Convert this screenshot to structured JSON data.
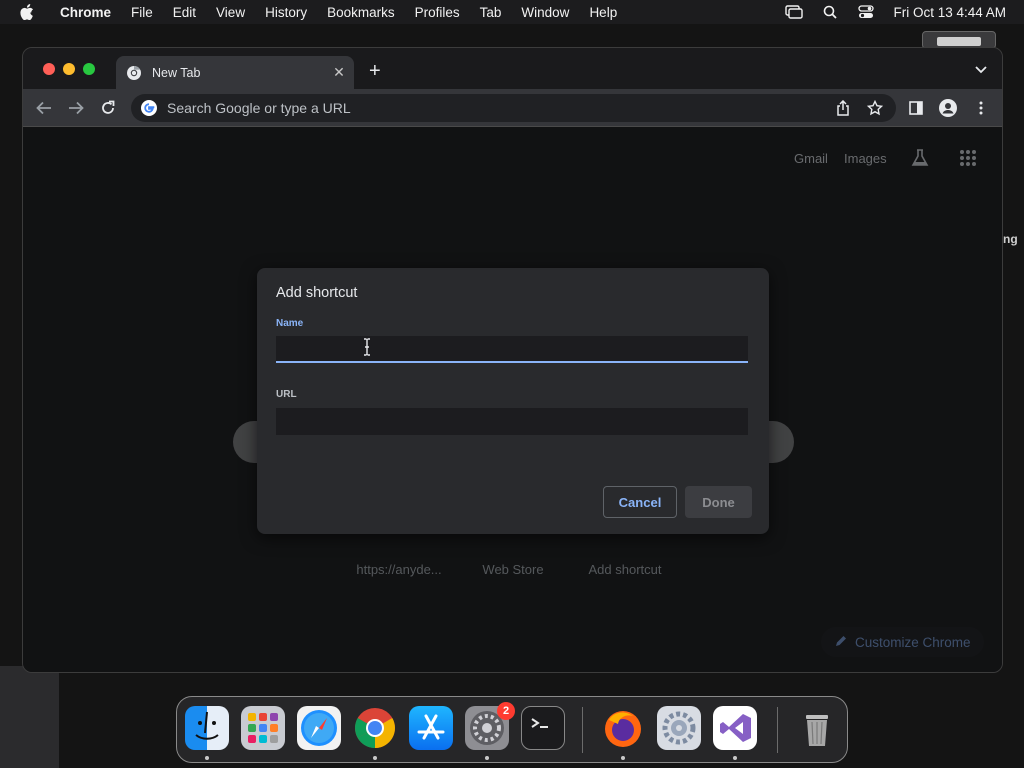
{
  "menubar": {
    "items": [
      "Chrome",
      "File",
      "Edit",
      "View",
      "History",
      "Bookmarks",
      "Profiles",
      "Tab",
      "Window",
      "Help"
    ],
    "clock": "Fri Oct 13  4:44 AM"
  },
  "desktop": {
    "edge_text": "ng"
  },
  "tab": {
    "title": "New Tab"
  },
  "omnibox": {
    "placeholder": "Search Google or type a URL"
  },
  "ntp": {
    "links": [
      "Gmail",
      "Images"
    ],
    "shortcuts": [
      "https://anyde...",
      "Web Store",
      "Add shortcut"
    ],
    "customize_label": "Customize Chrome"
  },
  "dialog": {
    "title": "Add shortcut",
    "name_label": "Name",
    "name_value": "",
    "url_label": "URL",
    "url_value": "",
    "cancel_label": "Cancel",
    "done_label": "Done"
  },
  "dock": {
    "apps": [
      "Finder",
      "Launchpad",
      "Safari",
      "Chrome",
      "App Store",
      "System Preferences",
      "Terminal",
      "Firefox",
      "Settings",
      "Visual Studio",
      "Trash"
    ],
    "system_preferences_badge": "2"
  },
  "colors": {
    "accent": "#8ab4f8",
    "window_bg": "#202124",
    "dialog_bg": "#292a2d"
  }
}
